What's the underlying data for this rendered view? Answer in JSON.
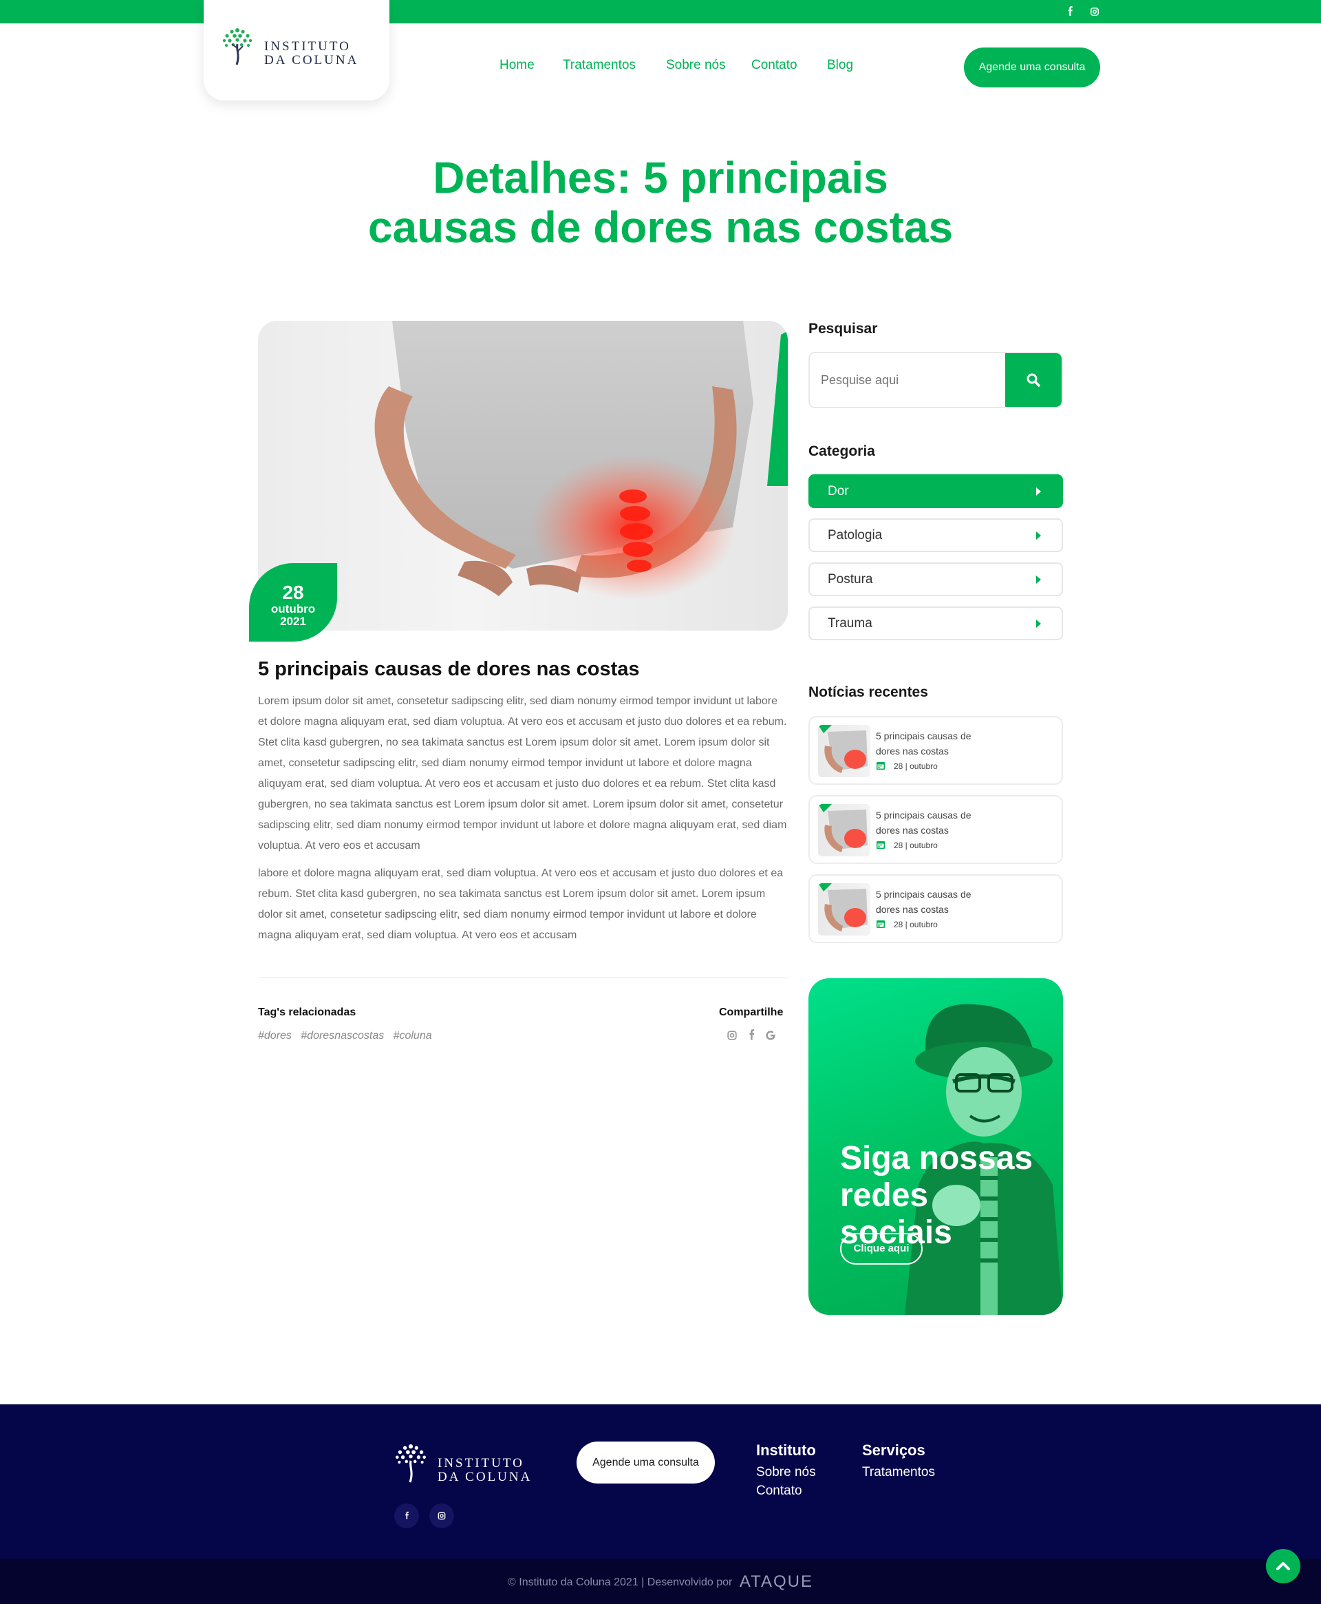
{
  "colors": {
    "brand_green": "#00b355",
    "footer_navy": "#05054a",
    "footer_bottom": "#04042e"
  },
  "topbar": {
    "icons": [
      "facebook-icon",
      "instagram-icon"
    ]
  },
  "logo": {
    "line1": "INSTITUTO",
    "line2": "DA COLUNA"
  },
  "nav": {
    "items": [
      "Home",
      "Tratamentos",
      "Sobre nós",
      "Contato",
      "Blog"
    ],
    "cta": "Agende uma consulta"
  },
  "page": {
    "title_line1": "Detalhes: 5 principais",
    "title_line2": "causas de dores nas costas"
  },
  "post": {
    "date_day": "28",
    "date_month": "outubro",
    "date_year": "2021",
    "title": "5 principais causas de dores nas costas",
    "paragraph1": "Lorem ipsum dolor sit amet, consetetur sadipscing elitr, sed diam nonumy eirmod tempor invidunt ut labore et dolore magna aliquyam erat, sed diam voluptua. At vero eos et accusam et justo duo dolores et ea rebum. Stet clita kasd gubergren, no sea takimata sanctus est Lorem ipsum dolor sit amet. Lorem ipsum dolor sit amet, consetetur sadipscing elitr, sed diam nonumy eirmod tempor invidunt ut labore et dolore magna aliquyam erat, sed diam voluptua. At vero eos et accusam et justo duo dolores et ea rebum. Stet clita kasd gubergren, no sea takimata sanctus est Lorem ipsum dolor sit amet. Lorem ipsum dolor sit amet, consetetur sadipscing elitr, sed diam nonumy eirmod tempor invidunt ut labore et dolore magna aliquyam erat, sed diam voluptua. At vero eos et accusam",
    "paragraph2": "labore et dolore magna aliquyam erat, sed diam voluptua. At vero eos et accusam et justo duo dolores et ea rebum. Stet clita kasd gubergren, no sea takimata sanctus est Lorem ipsum dolor sit amet. Lorem ipsum dolor sit amet, consetetur sadipscing elitr, sed diam nonumy eirmod tempor invidunt ut labore et dolore magna aliquyam erat, sed diam voluptua. At vero eos et accusam",
    "tags_heading": "Tag's relacionadas",
    "tags": [
      "#dores",
      "#doresnascostas",
      "#coluna"
    ],
    "share_heading": "Compartilhe",
    "share_icons": [
      "instagram-icon",
      "facebook-icon",
      "google-icon"
    ]
  },
  "sidebar": {
    "search_heading": "Pesquisar",
    "search_placeholder": "Pesquise aqui",
    "category_heading": "Categoria",
    "categories": [
      {
        "label": "Dor",
        "active": true
      },
      {
        "label": "Patologia",
        "active": false
      },
      {
        "label": "Postura",
        "active": false
      },
      {
        "label": "Trauma",
        "active": false
      }
    ],
    "recent_heading": "Notícias recentes",
    "recent": [
      {
        "title": "5 principais causas de dores nas costas",
        "date": "28 | outubro"
      },
      {
        "title": "5 principais causas de dores nas costas",
        "date": "28 | outubro"
      },
      {
        "title": "5 principais causas de dores nas costas",
        "date": "28 | outubro"
      }
    ],
    "promo_title_line1": "Siga nossas",
    "promo_title_line2": "redes sociais",
    "promo_button": "Clique aqui"
  },
  "footer": {
    "cta": "Agende uma consulta",
    "col1_heading": "Instituto",
    "col1_links": [
      "Sobre nós",
      "Contato"
    ],
    "col2_heading": "Serviços",
    "col2_links": [
      "Tratamentos"
    ],
    "social_icons": [
      "facebook-icon",
      "instagram-icon"
    ],
    "copyright": "© Instituto da Coluna 2021 | Desenvolvido por",
    "developer": "ATAQUE"
  }
}
